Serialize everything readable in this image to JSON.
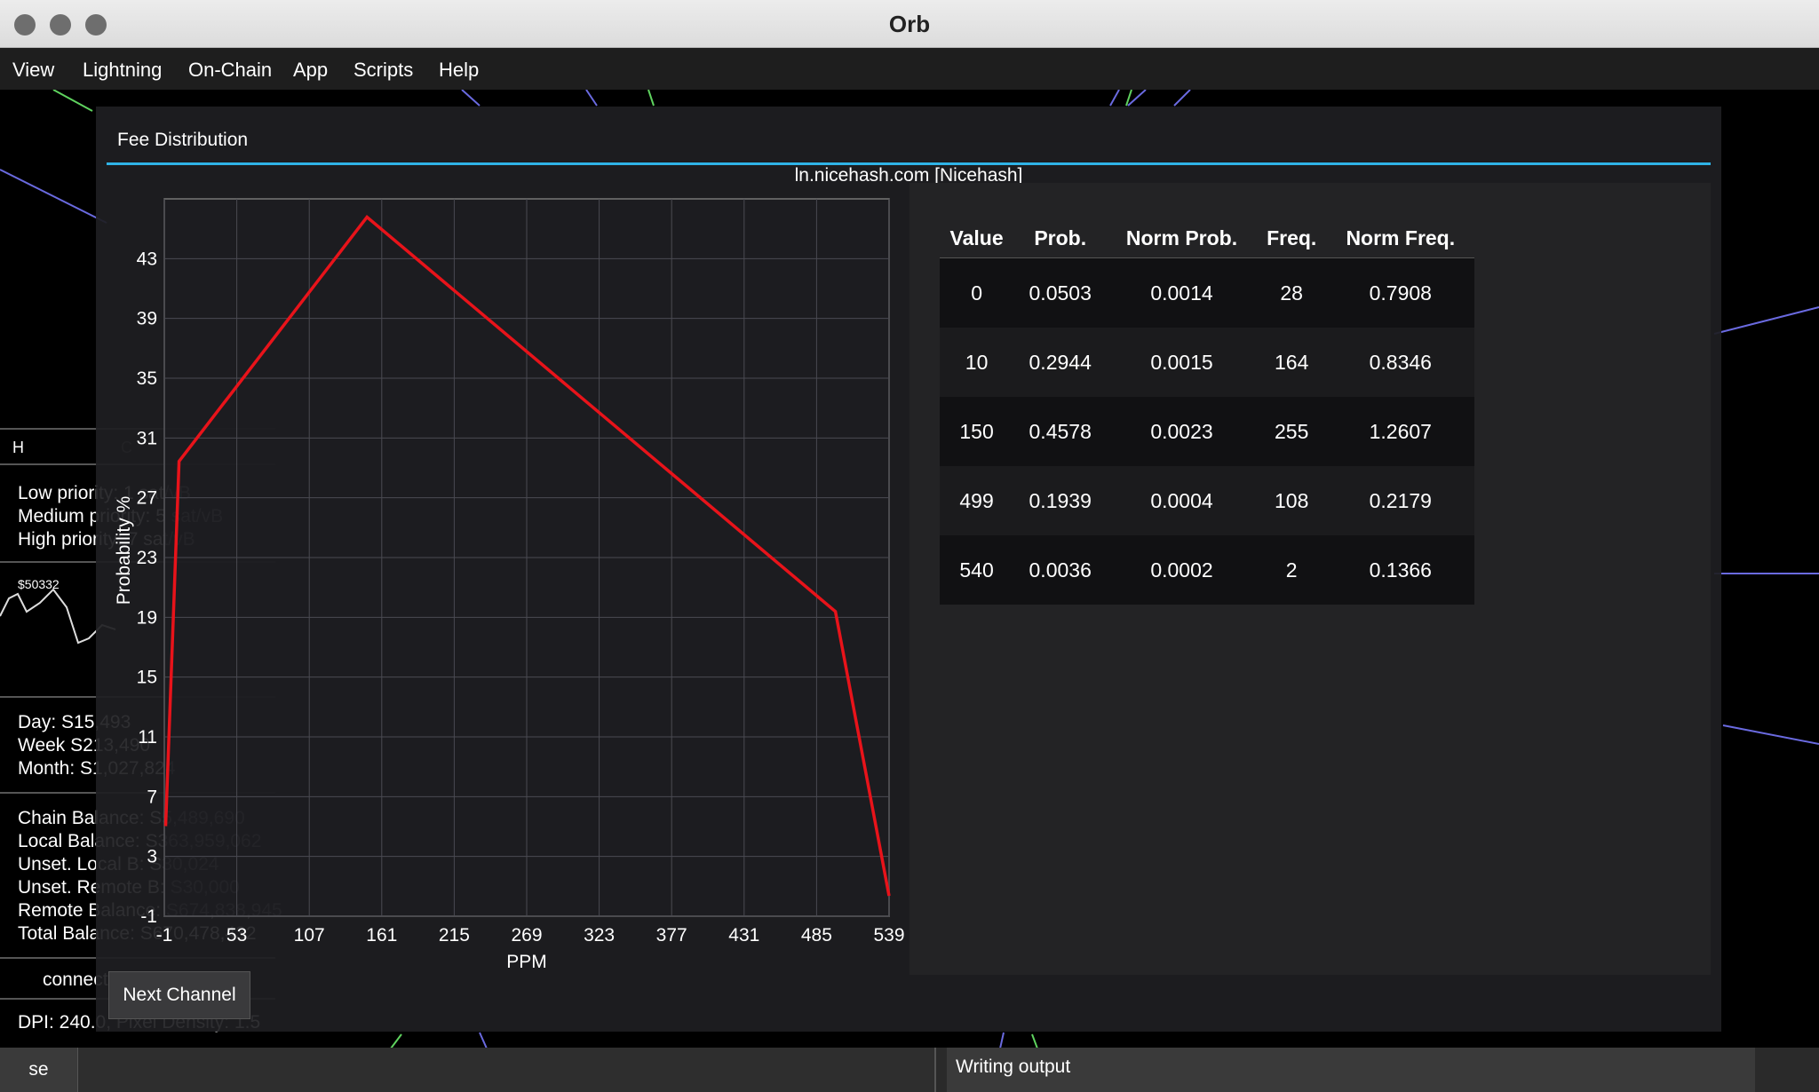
{
  "window": {
    "title": "Orb"
  },
  "menu": {
    "items": [
      "View",
      "Lightning",
      "On-Chain",
      "App",
      "Scripts",
      "Help"
    ]
  },
  "left_panel": {
    "tab_h": "H",
    "tab_c": "C",
    "fees": [
      "Low priority: 1 sat/vB",
      "Medium priority: 5 sat/vB",
      "High priority: 7 sat/vB"
    ],
    "price_label": "$50332",
    "earnings": [
      "Day: S15,493",
      "Week S213,490",
      "Month: S1,027,824"
    ],
    "balances": [
      "Chain Balance: S5,489,690",
      "Local Balance: S363,959,062",
      "Unset. Local B: S30,024",
      "Unset. Remote B: S30,000",
      "Remote Balance: S674,838,945",
      "Total Balance: S670,478,432"
    ],
    "connection": "connected",
    "dpi": "DPI: 240.0, Pixel Density: 1.5"
  },
  "modal": {
    "title": "Fee Distribution",
    "channel": "ln.nicehash.com [Nicehash]",
    "next_button": "Next Channel"
  },
  "chart_data": {
    "type": "line",
    "xlabel": "PPM",
    "ylabel": "Probability %",
    "x": [
      0,
      10,
      150,
      499,
      540
    ],
    "series": [
      {
        "values": [
          5.03,
          29.44,
          45.78,
          19.39,
          0.36
        ],
        "color": "#e8131a"
      }
    ],
    "xlim": [
      -1,
      539
    ],
    "ylim": [
      -1,
      47
    ],
    "xticks": [
      -1,
      53,
      107,
      161,
      215,
      269,
      323,
      377,
      431,
      485,
      539
    ],
    "yticks": [
      -1,
      3,
      7,
      11,
      15,
      19,
      23,
      27,
      31,
      35,
      39,
      43
    ],
    "grid": true
  },
  "table": {
    "headers": [
      "Value",
      "Prob.",
      "Norm Prob.",
      "Freq.",
      "Norm Freq."
    ],
    "rows": [
      [
        "0",
        "0.0503",
        "0.0014",
        "28",
        "0.7908"
      ],
      [
        "10",
        "0.2944",
        "0.0015",
        "164",
        "0.8346"
      ],
      [
        "150",
        "0.4578",
        "0.0023",
        "255",
        "1.2607"
      ],
      [
        "499",
        "0.1939",
        "0.0004",
        "108",
        "0.2179"
      ],
      [
        "540",
        "0.0036",
        "0.0002",
        "2",
        "0.1366"
      ]
    ]
  },
  "status": {
    "left": "se",
    "right": "Writing output"
  }
}
